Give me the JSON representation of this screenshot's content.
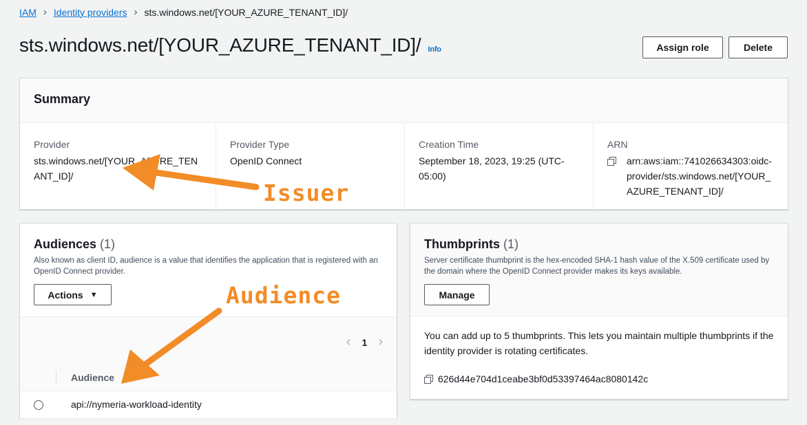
{
  "breadcrumb": {
    "root": "IAM",
    "parent": "Identity providers",
    "current": "sts.windows.net/[YOUR_AZURE_TENANT_ID]/"
  },
  "page": {
    "title": "sts.windows.net/[YOUR_AZURE_TENANT_ID]/",
    "info": "Info",
    "assign_role": "Assign role",
    "delete": "Delete"
  },
  "summary": {
    "title": "Summary",
    "provider_label": "Provider",
    "provider_value": "sts.windows.net/[YOUR_AZURE_TENANT_ID]/",
    "type_label": "Provider Type",
    "type_value": "OpenID Connect",
    "time_label": "Creation Time",
    "time_value": "September 18, 2023, 19:25 (UTC-05:00)",
    "arn_label": "ARN",
    "arn_value": "arn:aws:iam::741026634303:oidc-provider/sts.windows.net/[YOUR_AZURE_TENANT_ID]/"
  },
  "audiences": {
    "title": "Audiences",
    "count": "(1)",
    "description": "Also known as client ID, audience is a value that identifies the application that is registered with an OpenID Connect provider.",
    "actions": "Actions",
    "page_number": "1",
    "column_header": "Audience",
    "rows": [
      {
        "value": "api://nymeria-workload-identity"
      }
    ]
  },
  "thumbprints": {
    "title": "Thumbprints",
    "count": "(1)",
    "description": "Server certificate thumbprint is the hex-encoded SHA-1 hash value of the X.509 certificate used by the domain where the OpenID Connect provider makes its keys available.",
    "manage": "Manage",
    "note": "You can add up to 5 thumbprints. This lets you maintain multiple thumbprints if the identity provider is rotating certificates.",
    "items": [
      {
        "value": "626d44e704d1ceabe3bf0d53397464ac8080142c"
      }
    ]
  },
  "annotations": {
    "issuer": "Issuer",
    "audience": "Audience"
  },
  "colors": {
    "link": "#0972d3",
    "annotation": "#f28c28",
    "background": "#f2f3f3"
  }
}
